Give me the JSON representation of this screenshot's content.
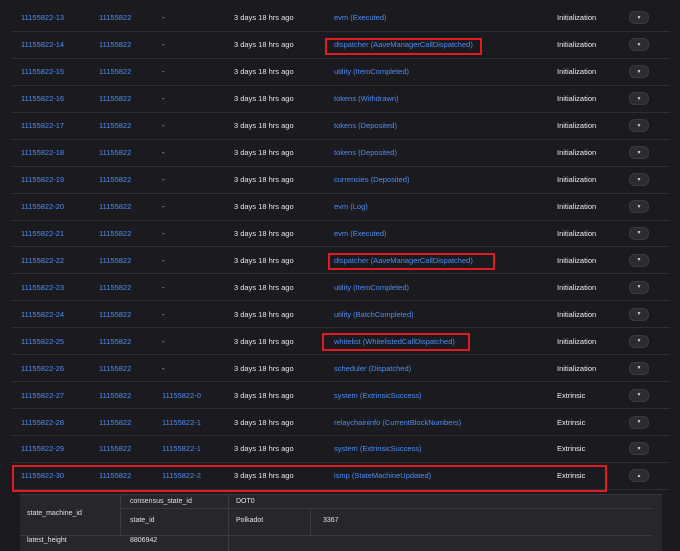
{
  "events": [
    {
      "id": "11155822-13",
      "block": "11155822",
      "extrinsic": "-",
      "time": "3 days 18 hrs ago",
      "action": "evm (Executed)",
      "result": "Initialization",
      "highlight": false,
      "expanded": false
    },
    {
      "id": "11155822-14",
      "block": "11155822",
      "extrinsic": "-",
      "time": "3 days 18 hrs ago",
      "action": "dispatcher (AaveManagerCallDispatched)",
      "result": "Initialization",
      "highlight": true,
      "expanded": false
    },
    {
      "id": "11155822-15",
      "block": "11155822",
      "extrinsic": "-",
      "time": "3 days 18 hrs ago",
      "action": "utility (ItemCompleted)",
      "result": "Initialization",
      "highlight": false,
      "expanded": false
    },
    {
      "id": "11155822-16",
      "block": "11155822",
      "extrinsic": "-",
      "time": "3 days 18 hrs ago",
      "action": "tokens (Withdrawn)",
      "result": "Initialization",
      "highlight": false,
      "expanded": false
    },
    {
      "id": "11155822-17",
      "block": "11155822",
      "extrinsic": "-",
      "time": "3 days 18 hrs ago",
      "action": "tokens (Deposited)",
      "result": "Initialization",
      "highlight": false,
      "expanded": false
    },
    {
      "id": "11155822-18",
      "block": "11155822",
      "extrinsic": "-",
      "time": "3 days 18 hrs ago",
      "action": "tokens (Deposited)",
      "result": "Initialization",
      "highlight": false,
      "expanded": false
    },
    {
      "id": "11155822-19",
      "block": "11155822",
      "extrinsic": "-",
      "time": "3 days 18 hrs ago",
      "action": "currencies (Deposited)",
      "result": "Initialization",
      "highlight": false,
      "expanded": false
    },
    {
      "id": "11155822-20",
      "block": "11155822",
      "extrinsic": "-",
      "time": "3 days 18 hrs ago",
      "action": "evm (Log)",
      "result": "Initialization",
      "highlight": false,
      "expanded": false
    },
    {
      "id": "11155822-21",
      "block": "11155822",
      "extrinsic": "-",
      "time": "3 days 18 hrs ago",
      "action": "evm (Executed)",
      "result": "Initialization",
      "highlight": false,
      "expanded": false
    },
    {
      "id": "11155822-22",
      "block": "11155822",
      "extrinsic": "-",
      "time": "3 days 18 hrs ago",
      "action": "dispatcher (AaveManagerCallDispatched)",
      "result": "Initialization",
      "highlight": true,
      "expanded": false
    },
    {
      "id": "11155822-23",
      "block": "11155822",
      "extrinsic": "-",
      "time": "3 days 18 hrs ago",
      "action": "utility (ItemCompleted)",
      "result": "Initialization",
      "highlight": false,
      "expanded": false
    },
    {
      "id": "11155822-24",
      "block": "11155822",
      "extrinsic": "-",
      "time": "3 days 18 hrs ago",
      "action": "utility (BatchCompleted)",
      "result": "Initialization",
      "highlight": false,
      "expanded": false
    },
    {
      "id": "11155822-25",
      "block": "11155822",
      "extrinsic": "-",
      "time": "3 days 18 hrs ago",
      "action": "whitelist (WhitelistedCallDispatched)",
      "result": "Initialization",
      "highlight": true,
      "expanded": false
    },
    {
      "id": "11155822-26",
      "block": "11155822",
      "extrinsic": "-",
      "time": "3 days 18 hrs ago",
      "action": "scheduler (Dispatched)",
      "result": "Initialization",
      "highlight": false,
      "expanded": false
    },
    {
      "id": "11155822-27",
      "block": "11155822",
      "extrinsic": "11155822-0",
      "time": "3 days 18 hrs ago",
      "action": "system (ExtrinsicSuccess)",
      "result": "Extrinsic",
      "highlight": false,
      "expanded": false
    },
    {
      "id": "11155822-28",
      "block": "11155822",
      "extrinsic": "11155822-1",
      "time": "3 days 18 hrs ago",
      "action": "relaychaininfo (CurrentBlockNumbers)",
      "result": "Extrinsic",
      "highlight": false,
      "expanded": false
    },
    {
      "id": "11155822-29",
      "block": "11155822",
      "extrinsic": "11155822-1",
      "time": "3 days 18 hrs ago",
      "action": "system (ExtrinsicSuccess)",
      "result": "Extrinsic",
      "highlight": false,
      "expanded": false
    },
    {
      "id": "11155822-30",
      "block": "11155822",
      "extrinsic": "11155822-2",
      "time": "3 days 18 hrs ago",
      "action": "ismp (StateMachineUpdated)",
      "result": "Extrinsic",
      "highlight": true,
      "expanded": true
    }
  ],
  "detail": {
    "state_machine_id_label": "state_machine_id",
    "consensus_state_id_label": "consensus_state_id",
    "consensus_state_id_value": "DOT0",
    "state_id_label": "state_id",
    "state_id_network": "Polkadot",
    "state_id_value": "3367",
    "latest_height_label": "latest_height",
    "latest_height_value": "8806942"
  },
  "colors": {
    "link": "#4c8df6",
    "highlight": "#e01b24",
    "background": "#1b1b1f"
  }
}
